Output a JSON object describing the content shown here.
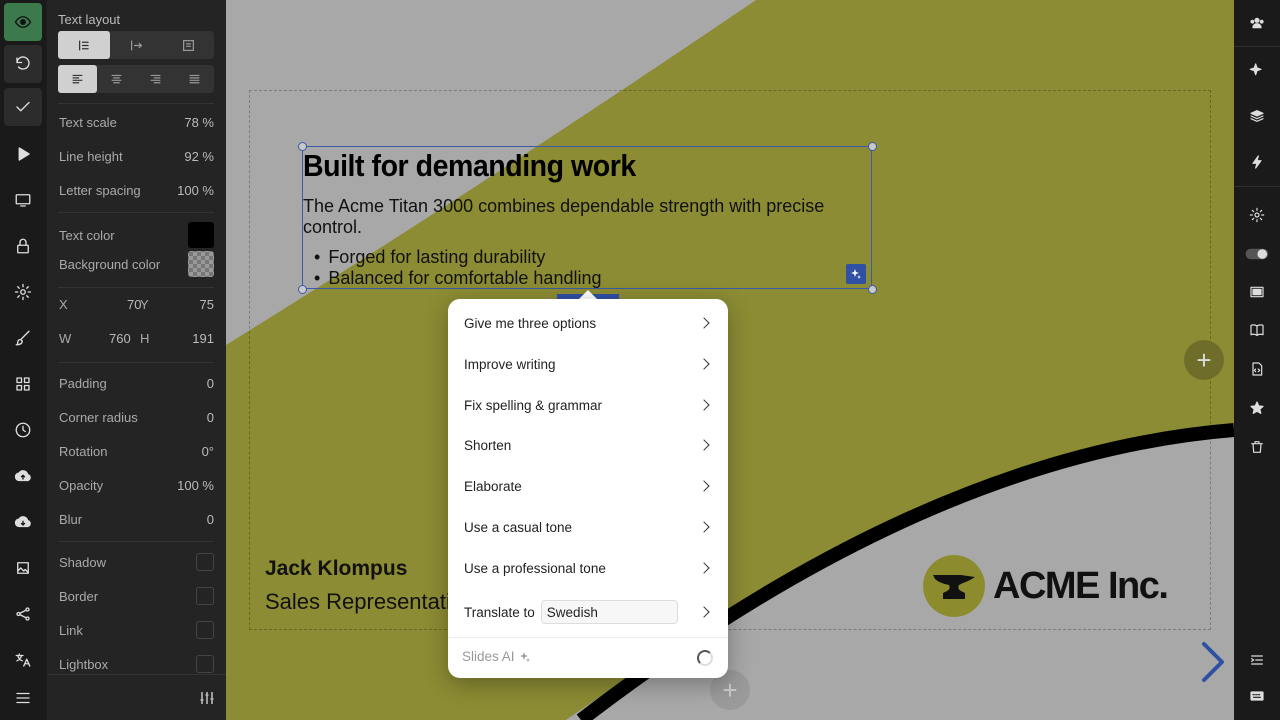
{
  "panel": {
    "title": "Text layout",
    "text_scale": {
      "label": "Text scale",
      "value": "78 %"
    },
    "line_height": {
      "label": "Line height",
      "value": "92 %"
    },
    "letter_spacing": {
      "label": "Letter spacing",
      "value": "100 %"
    },
    "text_color": {
      "label": "Text color",
      "color": "#000000"
    },
    "background_color": {
      "label": "Background color"
    },
    "x": {
      "label": "X",
      "value": "70"
    },
    "y": {
      "label": "Y",
      "value": "75"
    },
    "w": {
      "label": "W",
      "value": "760"
    },
    "h": {
      "label": "H",
      "value": "191"
    },
    "padding": {
      "label": "Padding",
      "value": "0"
    },
    "corner_radius": {
      "label": "Corner radius",
      "value": "0"
    },
    "rotation": {
      "label": "Rotation",
      "value": "0°"
    },
    "opacity": {
      "label": "Opacity",
      "value": "100 %"
    },
    "blur": {
      "label": "Blur",
      "value": "0"
    },
    "shadow": {
      "label": "Shadow"
    },
    "border": {
      "label": "Border"
    },
    "link": {
      "label": "Link"
    },
    "lightbox": {
      "label": "Lightbox"
    }
  },
  "slide": {
    "heading": "Built for demanding work",
    "paragraph": "The Acme Titan 3000 combines dependable strength with precise control.",
    "bullets": [
      "Forged for lasting durability",
      "Balanced for comfortable handling"
    ],
    "person_name": "Jack Klompus",
    "person_role": "Sales Representative",
    "logo_text": "ACME Inc.",
    "colors": {
      "olive": "#8c8c34",
      "gray": "#a8a8a8",
      "black": "#000000",
      "accent": "#2f50a3"
    }
  },
  "ai_menu": {
    "items": [
      "Give me three options",
      "Improve writing",
      "Fix spelling & grammar",
      "Shorten",
      "Elaborate",
      "Use a casual tone",
      "Use a professional tone"
    ],
    "translate_label": "Translate to",
    "translate_value": "Swedish",
    "footer_label": "Slides AI"
  }
}
